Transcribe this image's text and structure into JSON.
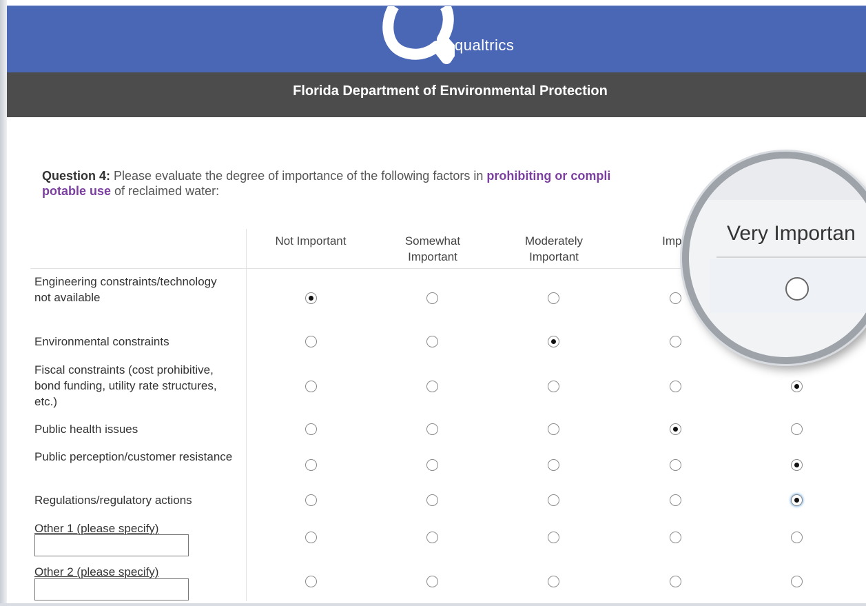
{
  "brand": {
    "name": "qualtrics",
    "logo_letter": "Q",
    "bar_color": "#4a67b6"
  },
  "header": {
    "title": "Florida Department of Environmental Protection",
    "bar_color": "#4c4c4c"
  },
  "question": {
    "label": "Question 4:",
    "text_before": " Please evaluate the degree of importance of the following factors in ",
    "emphasis1": "prohibiting or compli",
    "emphasis2": "potable use",
    "text_after": " of reclaimed water:"
  },
  "columns": [
    {
      "line1": "",
      "line2": "Not Important"
    },
    {
      "line1": "Somewhat",
      "line2": "Important"
    },
    {
      "line1": "Moderately",
      "line2": "Important"
    },
    {
      "line1": "",
      "line2": "Impo"
    }
  ],
  "rows": [
    {
      "label": "Engineering constraints/technology not available",
      "selected": 0
    },
    {
      "label": "Environmental constraints",
      "selected": 2
    },
    {
      "label": "Fiscal constraints (cost prohibitive, bond funding, utility rate structures, etc.)",
      "selected": 4
    },
    {
      "label": "Public health issues",
      "selected": 3
    },
    {
      "label": "Public perception/customer resistance",
      "selected": 4
    },
    {
      "label": "Regulations/regulatory actions",
      "selected": 4
    },
    {
      "label": "Other 1 (please specify)",
      "selected": null,
      "input_value": ""
    },
    {
      "label": "Other 2 (please specify)",
      "selected": null,
      "input_value": ""
    }
  ],
  "magnifier": {
    "column_label": "Very Importan"
  }
}
